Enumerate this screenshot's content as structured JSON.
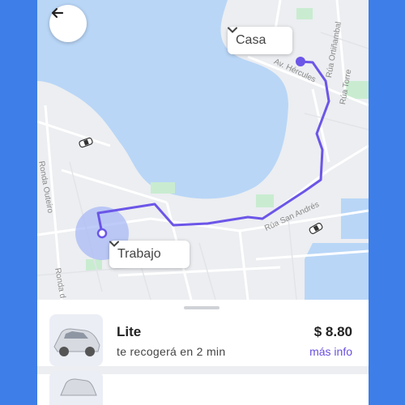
{
  "map": {
    "origin_label": "Casa",
    "destination_label": "Trabajo",
    "streets": [
      "Av. Hércules",
      "Rúa Ortiñambal",
      "Rúa Torre",
      "Rúa San Andrés",
      "Ronda Outeiro",
      "Ronda d"
    ]
  },
  "ride": {
    "name": "Lite",
    "eta": "te recogerá en 2 min",
    "price": "$ 8.80",
    "more_info": "más info"
  },
  "colors": {
    "accent": "#6a4fe0",
    "route": "#6b56e8",
    "water": "#b9d6f7",
    "park": "#c9ecd0",
    "background": "#3d7ee8"
  },
  "icons": {
    "back": "arrow-left-icon",
    "dropdown": "chevron-down-icon"
  }
}
